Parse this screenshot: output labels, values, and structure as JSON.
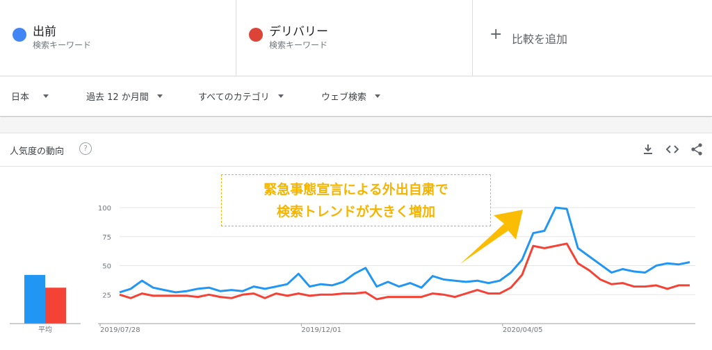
{
  "terms": [
    {
      "name": "出前",
      "sub": "検索キーワード",
      "color": "#4285f4"
    },
    {
      "name": "デリバリー",
      "sub": "検索キーワード",
      "color": "#db4437"
    }
  ],
  "add_compare": {
    "plus": "+",
    "label": "比較を追加"
  },
  "filters": {
    "region": "日本",
    "period": "過去 12 か月間",
    "category": "すべてのカテゴリ",
    "search_type": "ウェブ検索"
  },
  "card": {
    "title": "人気度の動向",
    "help": "?"
  },
  "icons": {
    "download": "download-icon",
    "embed": "embed-code-icon",
    "share": "share-icon",
    "help": "help-icon"
  },
  "callout": {
    "line1": "緊急事態宣言による外出自粛で",
    "line2": "検索トレンドが大きく増加"
  },
  "chart_data": {
    "type": "line",
    "y_ticks": [
      "100",
      "75",
      "50",
      "25"
    ],
    "ylim": [
      0,
      100
    ],
    "x_labels": [
      "2019/07/28",
      "2019/12/01",
      "2020/04/05"
    ],
    "x_label_index": [
      0,
      18,
      36
    ],
    "series": [
      {
        "name": "出前",
        "color": "#2196f3",
        "values": [
          27,
          30,
          37,
          31,
          29,
          27,
          28,
          30,
          31,
          28,
          29,
          28,
          32,
          30,
          32,
          34,
          43,
          32,
          34,
          33,
          36,
          43,
          48,
          32,
          36,
          32,
          35,
          31,
          41,
          38,
          37,
          36,
          37,
          35,
          37,
          44,
          55,
          78,
          80,
          100,
          99,
          65,
          58,
          51,
          44,
          47,
          45,
          44,
          50,
          52,
          51,
          53
        ]
      },
      {
        "name": "デリバリー",
        "color": "#f44336",
        "values": [
          25,
          22,
          26,
          24,
          24,
          24,
          24,
          23,
          25,
          23,
          22,
          25,
          26,
          22,
          26,
          24,
          26,
          24,
          25,
          25,
          26,
          26,
          27,
          21,
          23,
          23,
          23,
          23,
          26,
          25,
          23,
          26,
          29,
          26,
          26,
          31,
          42,
          67,
          65,
          67,
          69,
          52,
          46,
          38,
          34,
          35,
          32,
          32,
          33,
          30,
          33,
          33
        ]
      }
    ],
    "average": {
      "label": "平均",
      "values": [
        42,
        31
      ]
    },
    "grid": true
  }
}
